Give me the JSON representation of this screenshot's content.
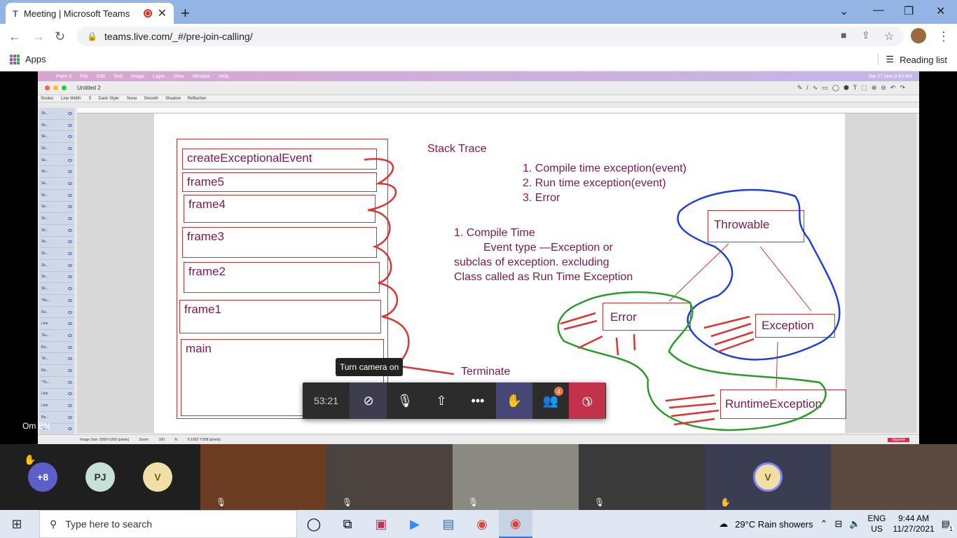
{
  "browser": {
    "tab_title": "Meeting | Microsoft Teams",
    "url": "teams.live.com/_#/pre-join-calling/",
    "bookmarks_apps": "Apps",
    "reading_list": "Reading list"
  },
  "mac": {
    "menu": [
      "Paint S",
      "File",
      "Edit",
      "Tool",
      "Image",
      "Layer",
      "View",
      "Window",
      "Help"
    ],
    "menu_right": "Sat 27 Nov 9:43 AM",
    "doc_title": "Untitled 2",
    "options": [
      "Stroke:",
      "Line Width:",
      "5",
      "Dash Style:",
      "None",
      "Smooth",
      "Shadow",
      "Reflection"
    ],
    "status": [
      "Image Size: 2000×1200 (pixels)",
      "Zoom:",
      "100",
      "%",
      "X:1052 Y:568 (pixels)"
    ],
    "upgrade": "Upgrade",
    "layers": [
      "Sk...",
      "Sk...",
      "Sk...",
      "Sk...",
      "Sk...",
      "Sk...",
      "Sk...",
      "Sk...",
      "Sk...",
      "Sk...",
      "Sk...",
      "Sk...",
      "Sk...",
      "Sk...",
      "Sk...",
      "Sk...",
      "\"Ru...",
      "Re...",
      "Line",
      "\"Ex...",
      "Re...",
      "\"Er...",
      "Re...",
      "\"Th...",
      "Line",
      "Line",
      "Re...",
      "\"1..."
    ]
  },
  "drawing": {
    "frames": [
      "createExceptionalEvent",
      "frame5",
      "frame4",
      "frame3",
      "frame2",
      "frame1",
      "main"
    ],
    "stack_trace": "Stack Trace",
    "list": [
      "1. Compile time exception(event)",
      "2. Run time exception(event)",
      "3. Error"
    ],
    "note": [
      "1. Compile Time",
      "Event type —Exception or",
      "subclas of exception. excluding",
      "Class called as Run Time Exception"
    ],
    "hierarchy": [
      "Throwable",
      "Error",
      "Exception",
      "RuntimeException"
    ],
    "terminate": "Terminate"
  },
  "meeting": {
    "presenter": "Om BN",
    "tooltip": "Turn camera on",
    "timer": "53:21",
    "people_badge": "4",
    "participants": [
      {
        "label": "+8",
        "color": "#5b5fc7"
      },
      {
        "label": "PJ",
        "color": "#c8e0d8"
      },
      {
        "label": "V",
        "color": "#f1dfa8"
      }
    ],
    "v_tile": "V"
  },
  "taskbar": {
    "search_placeholder": "Type here to search",
    "weather": "29°C  Rain showers",
    "lang1": "ENG",
    "lang2": "US",
    "time": "9:44 AM",
    "date": "11/27/2021",
    "notif": "1"
  }
}
